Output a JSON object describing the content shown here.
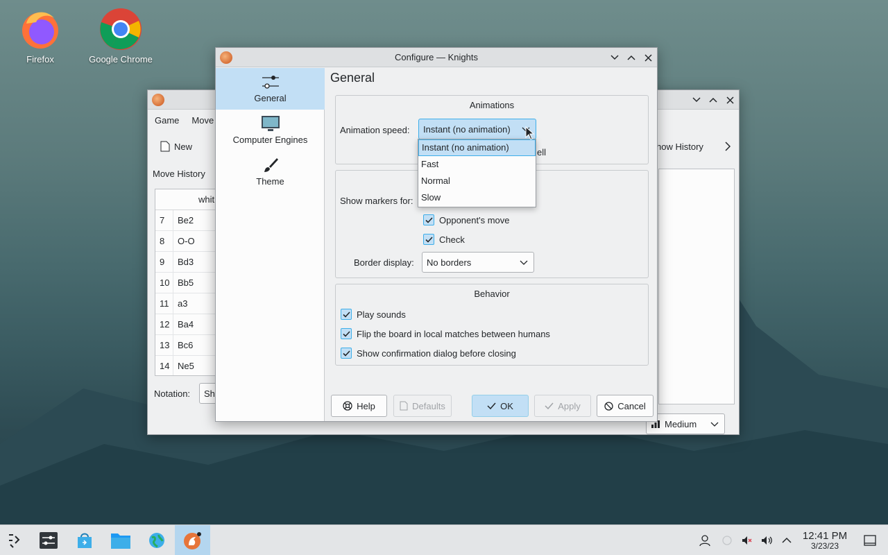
{
  "desktop": {
    "icons": [
      {
        "label": "Firefox"
      },
      {
        "label": "Google Chrome"
      }
    ]
  },
  "back_window": {
    "menu": [
      "Game",
      "Move"
    ],
    "toolbar": {
      "new_label": "New",
      "show_history_label": "how History"
    },
    "panel_title": "Move History",
    "table_header": "whit",
    "moves": [
      {
        "n": "7",
        "m": "Be2"
      },
      {
        "n": "8",
        "m": "O-O"
      },
      {
        "n": "9",
        "m": "Bd3"
      },
      {
        "n": "10",
        "m": "Bb5"
      },
      {
        "n": "11",
        "m": "a3"
      },
      {
        "n": "12",
        "m": "Ba4"
      },
      {
        "n": "13",
        "m": "Bc6"
      },
      {
        "n": "14",
        "m": "Ne5"
      }
    ],
    "notation_label": "Notation:",
    "notation_value": "Sho",
    "difficulty_value": "Medium"
  },
  "dialog": {
    "title": "Configure — Knights",
    "sidebar": [
      {
        "label": "General",
        "icon": "sliders-icon",
        "active": true
      },
      {
        "label": "Computer Engines",
        "icon": "monitor-icon",
        "active": false
      },
      {
        "label": "Theme",
        "icon": "brush-icon",
        "active": false
      }
    ],
    "page_title": "General",
    "animations": {
      "title": "Animations",
      "speed_label": "Animation speed:",
      "speed_value": "Instant (no animation)",
      "hidden_text": "ell",
      "options": [
        "Instant (no animation)",
        "Fast",
        "Normal",
        "Slow"
      ]
    },
    "markers": {
      "show_label": "Show markers for:",
      "opponent_move": "Opponent's move",
      "check": "Check",
      "border_label": "Border display:",
      "border_value": "No borders"
    },
    "behavior": {
      "title": "Behavior",
      "play_sounds": "Play sounds",
      "flip_board": "Flip the board in local matches between humans",
      "confirm_close": "Show confirmation dialog before closing"
    },
    "buttons": {
      "help": "Help",
      "defaults": "Defaults",
      "ok": "OK",
      "apply": "Apply",
      "cancel": "Cancel"
    }
  },
  "taskbar": {
    "time": "12:41 PM",
    "date": "3/23/23"
  },
  "colors": {
    "accent": "#3daee9",
    "selection": "#c2dff5"
  }
}
